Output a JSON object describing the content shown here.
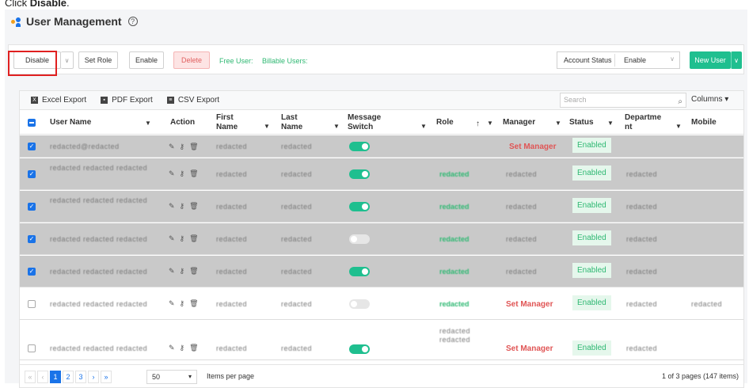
{
  "instruction": {
    "prefix": "Click ",
    "target": "Disable",
    "suffix": "."
  },
  "page": {
    "title": "User Management",
    "help": "?"
  },
  "toolbar": {
    "disable": "Disable",
    "disable_arrow": "∨",
    "set_role": "Set Role",
    "enable": "Enable",
    "delete": "Delete",
    "free_user": "Free User: ",
    "billable_users": "Billable Users: ",
    "account_status_label": "Account Status",
    "account_status_value": "Enable",
    "new_user": "New User",
    "new_user_arrow": "∨"
  },
  "exports": {
    "excel": "Excel Export",
    "pdf": "PDF Export",
    "csv": "CSV Export"
  },
  "search": {
    "placeholder": "Search",
    "icon": "search-icon"
  },
  "columns_btn": "Columns ▾",
  "headers": {
    "user_name": "User Name",
    "action": "Action",
    "first_name": "First Name",
    "last_name": "Last Name",
    "message_switch": "Message Switch",
    "role": "Role",
    "manager": "Manager",
    "status": "Status",
    "department": "Departme nt",
    "mobile": "Mobile"
  },
  "rows": [
    {
      "user": "redacted@redacted",
      "first": "redacted",
      "last": "redacted",
      "role": "",
      "manager": "Set Manager",
      "status": "Enabled",
      "dept": "",
      "mobile": ""
    },
    {
      "user": "redacted redacted redacted",
      "first": "redacted",
      "last": "redacted",
      "role": "redacted",
      "manager": "redacted",
      "status": "Enabled",
      "dept": "redacted",
      "mobile": ""
    },
    {
      "user": "redacted redacted redacted",
      "first": "redacted",
      "last": "redacted",
      "role": "redacted",
      "manager": "redacted",
      "status": "Enabled",
      "dept": "redacted",
      "mobile": ""
    },
    {
      "user": "redacted redacted redacted",
      "first": "redacted",
      "last": "redacted",
      "role": "redacted",
      "manager": "redacted",
      "status": "Enabled",
      "dept": "redacted",
      "mobile": ""
    },
    {
      "user": "redacted redacted redacted",
      "first": "redacted",
      "last": "redacted",
      "role": "redacted",
      "manager": "redacted",
      "status": "Enabled",
      "dept": "redacted",
      "mobile": ""
    },
    {
      "user": "redacted redacted redacted",
      "first": "redacted",
      "last": "redacted",
      "role": "redacted",
      "manager": "Set Manager",
      "status": "Enabled",
      "dept": "redacted",
      "mobile": "redacted"
    },
    {
      "user": "redacted redacted redacted",
      "first": "redacted",
      "last": "redacted",
      "role": "redacted redacted",
      "manager": "Set Manager",
      "status": "Enabled",
      "dept": "redacted",
      "mobile": ""
    }
  ],
  "pager": {
    "first": "«",
    "prev": "‹",
    "p1": "1",
    "p2": "2",
    "p3": "3",
    "next": "›",
    "last": "»",
    "per_page": "50",
    "per_page_label": "Items per page",
    "info": "1 of 3 pages (147 items)"
  }
}
